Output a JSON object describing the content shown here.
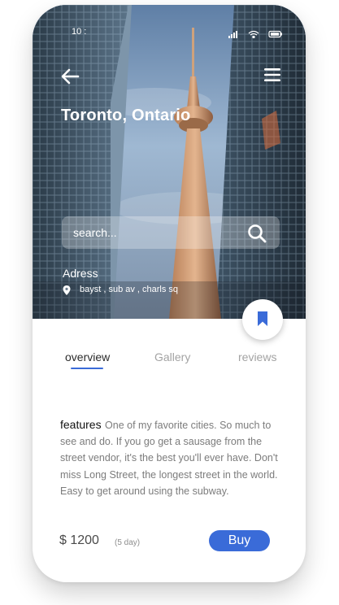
{
  "status_bar": {
    "time": "10 :",
    "icons": [
      "signal-icon",
      "wifi-icon",
      "battery-icon"
    ]
  },
  "header": {
    "back_icon": "arrow-left-icon",
    "menu_icon": "hamburger-menu-icon",
    "title": "Toronto, Ontario"
  },
  "search": {
    "placeholder": "search...",
    "value": "",
    "icon": "search-icon"
  },
  "address": {
    "label": "Adress",
    "icon": "location-pin-icon",
    "value": "bayst , sub av , charls sq"
  },
  "bookmark": {
    "icon": "bookmark-icon",
    "color": "#3a6bd8"
  },
  "tabs": [
    {
      "label": "overview",
      "active": true
    },
    {
      "label": "Gallery",
      "active": false
    },
    {
      "label": "reviews",
      "active": false
    }
  ],
  "features": {
    "title": "features",
    "body": "One of my favorite cities. So much to see and do. If you go get a sausage from the street vendor, it's the best you'll ever have. Don't miss Long Street, the longest street in the world. Easy to get around using the subway."
  },
  "purchase": {
    "price": "$ 1200",
    "duration": "(5 day)",
    "buy_label": "Buy"
  },
  "colors": {
    "accent": "#3a6bd8",
    "inactive_tab": "#a3a3a3",
    "body_text": "#7c7c7c"
  }
}
